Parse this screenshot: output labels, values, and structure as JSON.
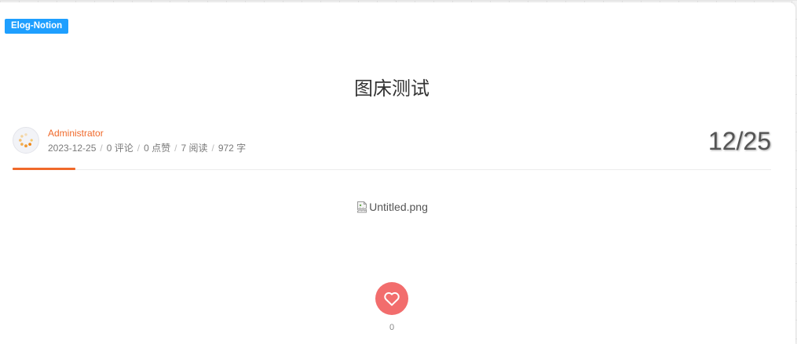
{
  "tag": {
    "label": "Elog-Notion"
  },
  "post": {
    "title": "图床测试",
    "author": "Administrator",
    "meta": {
      "date": "2023-12-25",
      "separator": "/",
      "comments": "0 评论",
      "likes": "0 点赞",
      "views": "7 阅读",
      "words": "972 字"
    },
    "date_badge": "12/25",
    "image_alt": "Untitled.png"
  },
  "like": {
    "count": "0"
  },
  "icons": {
    "avatar": "loading-spinner-icon",
    "image": "broken-image-icon",
    "like": "heart-outline-icon"
  },
  "colors": {
    "tag_bg": "#1e9fff",
    "accent": "#f0692a",
    "like_bg": "#f26d6d",
    "text": "#333333",
    "muted": "#7a7a7a"
  }
}
